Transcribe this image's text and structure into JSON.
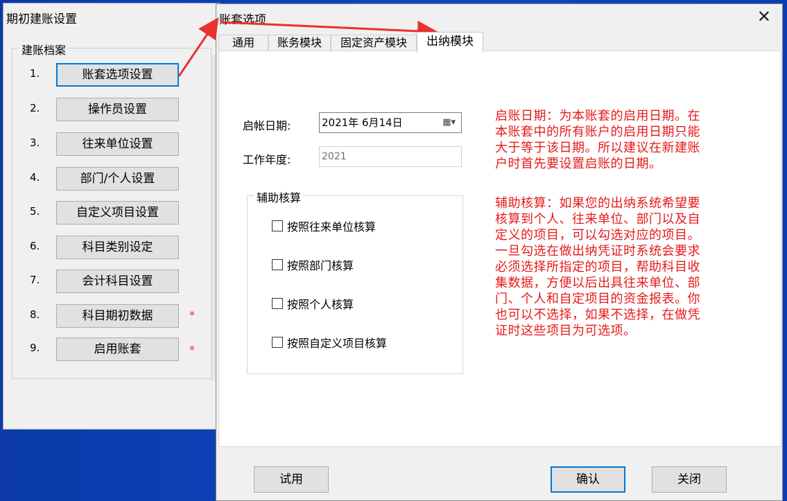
{
  "background_window": {
    "title": "期初建账设置",
    "group_label": "建账档案",
    "items": [
      {
        "num": "1.",
        "label": "账套选项设置",
        "star": ""
      },
      {
        "num": "2.",
        "label": "操作员设置",
        "star": ""
      },
      {
        "num": "3.",
        "label": "往来单位设置",
        "star": ""
      },
      {
        "num": "4.",
        "label": "部门/个人设置",
        "star": ""
      },
      {
        "num": "5.",
        "label": "自定义项目设置",
        "star": ""
      },
      {
        "num": "6.",
        "label": "科目类别设定",
        "star": ""
      },
      {
        "num": "7.",
        "label": "会计科目设置",
        "star": ""
      },
      {
        "num": "8.",
        "label": "科目期初数据",
        "star": "*"
      },
      {
        "num": "9.",
        "label": "启用账套",
        "star": "*"
      }
    ]
  },
  "dialog": {
    "title": "账套选项",
    "tabs": [
      "通用",
      "账务模块",
      "固定资产模块",
      "出纳模块"
    ],
    "active_tab": "出纳模块",
    "start_date_label": "启帐日期:",
    "start_date_value": "2021年  6月14日",
    "work_year_label": "工作年度:",
    "work_year_value": "2021",
    "aux_group_label": "辅助核算",
    "checkboxes": [
      {
        "label": "按照往来单位核算",
        "checked": false
      },
      {
        "label": "按照部门核算",
        "checked": false
      },
      {
        "label": "按照个人核算",
        "checked": false
      },
      {
        "label": "按照自定义项目核算",
        "checked": false
      }
    ],
    "note_start_date": "启账日期：为本账套的启用日期。在本账套中的所有账户的启用日期只能大于等于该日期。所以建议在新建账户时首先要设置启账的日期。",
    "note_aux": "辅助核算：如果您的出纳系统希望要核算到个人、往来单位、部门以及自定义的项目，可以勾选对应的项目。一旦勾选在做出纳凭证时系统会要求必须选择所指定的项目，帮助科目收集数据，方便以后出具往来单位、部门、个人和自定项目的资金报表。你也可以不选择，如果不选择，在做凭证时这些项目为可选项。",
    "buttons": {
      "trial": "试用",
      "ok": "确认",
      "close": "关闭"
    }
  },
  "colors": {
    "note_red": "#e61919",
    "accent_blue": "#0078d7",
    "desktop": "#0c48c4"
  }
}
